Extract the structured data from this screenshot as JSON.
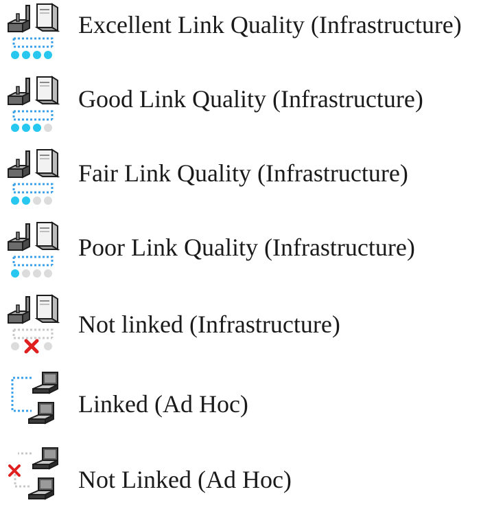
{
  "legend": {
    "items": [
      {
        "label": "Excellent Link Quality (Infrastructure)",
        "icon": "infrastructure-link-excellent-icon",
        "signal_level": 4,
        "signal_max": 4
      },
      {
        "label": "Good Link Quality (Infrastructure)",
        "icon": "infrastructure-link-good-icon",
        "signal_level": 3,
        "signal_max": 4
      },
      {
        "label": "Fair Link Quality (Infrastructure)",
        "icon": "infrastructure-link-fair-icon",
        "signal_level": 2,
        "signal_max": 4
      },
      {
        "label": "Poor Link Quality (Infrastructure)",
        "icon": "infrastructure-link-poor-icon",
        "signal_level": 1,
        "signal_max": 4
      },
      {
        "label": "Not linked (Infrastructure)",
        "icon": "infrastructure-not-linked-icon",
        "signal_level": 0,
        "signal_max": 4
      },
      {
        "label": "Linked (Ad Hoc)",
        "icon": "adhoc-linked-icon"
      },
      {
        "label": "Not Linked (Ad Hoc)",
        "icon": "adhoc-not-linked-icon"
      }
    ]
  },
  "colors": {
    "signal_on": "#27c7f0",
    "signal_off": "#dcdcdc",
    "link_dots": "#3aa0e8",
    "link_dots_off": "#c8c8c8",
    "error_x": "#e02020",
    "text": "#1a1a1a"
  }
}
